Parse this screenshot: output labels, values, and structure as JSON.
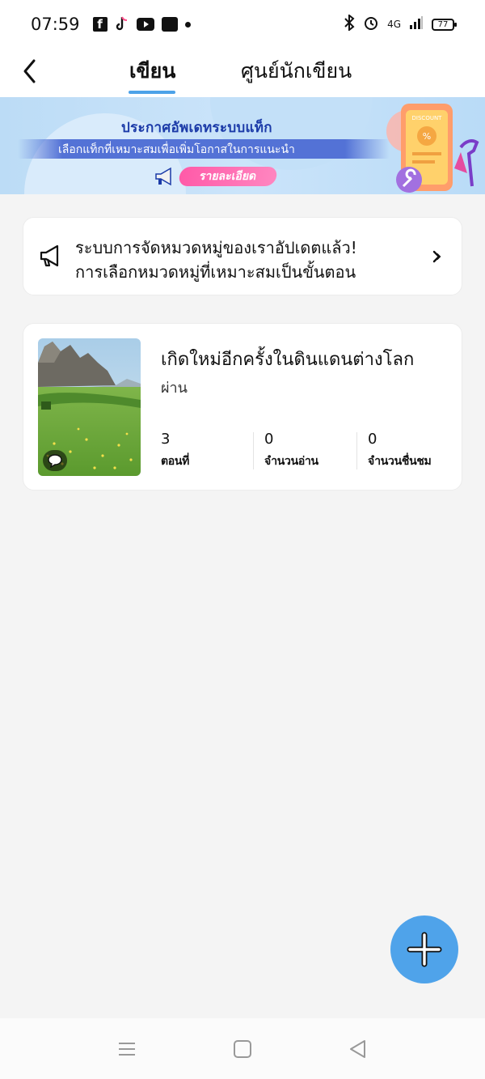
{
  "status_bar": {
    "time": "07:59",
    "network": "4G",
    "battery": "77"
  },
  "header": {
    "tabs": [
      {
        "label": "เขียน",
        "active": true
      },
      {
        "label": "ศูนย์นักเขียน",
        "active": false
      }
    ]
  },
  "banner": {
    "title": "ประกาศอัพเดทระบบแท็ก",
    "subtitle": "เลือกแท็กที่เหมาะสมเพื่อเพิ่มโอกาสในการแนะนำ",
    "button_label": "รายละเอียด",
    "art_label": "DISCOUNT"
  },
  "notice": {
    "lines": [
      "ระบบการจัดหมวดหมู่ของเราอัปเดตแล้ว!",
      "การเลือกหมวดหมู่ที่เหมาะสมเป็นขั้นตอน"
    ]
  },
  "novels": [
    {
      "title": "เกิดใหม่อีกครั้งในดินแดนต่างโลก",
      "status": "ผ่าน",
      "stats": [
        {
          "value": "3",
          "label": "ตอนที่"
        },
        {
          "value": "0",
          "label": "จำนวนอ่าน"
        },
        {
          "value": "0",
          "label": "จำนวนชื่นชม"
        }
      ]
    }
  ],
  "colors": {
    "accent": "#4ca2e8",
    "fab": "#4fa3ea",
    "background": "#f4f4f4"
  },
  "icons": [
    "back-arrow-icon",
    "megaphone-icon",
    "chevron-right-icon",
    "comment-bubble-icon",
    "plus-icon",
    "menu-icon",
    "home-icon",
    "back-triangle-icon"
  ]
}
